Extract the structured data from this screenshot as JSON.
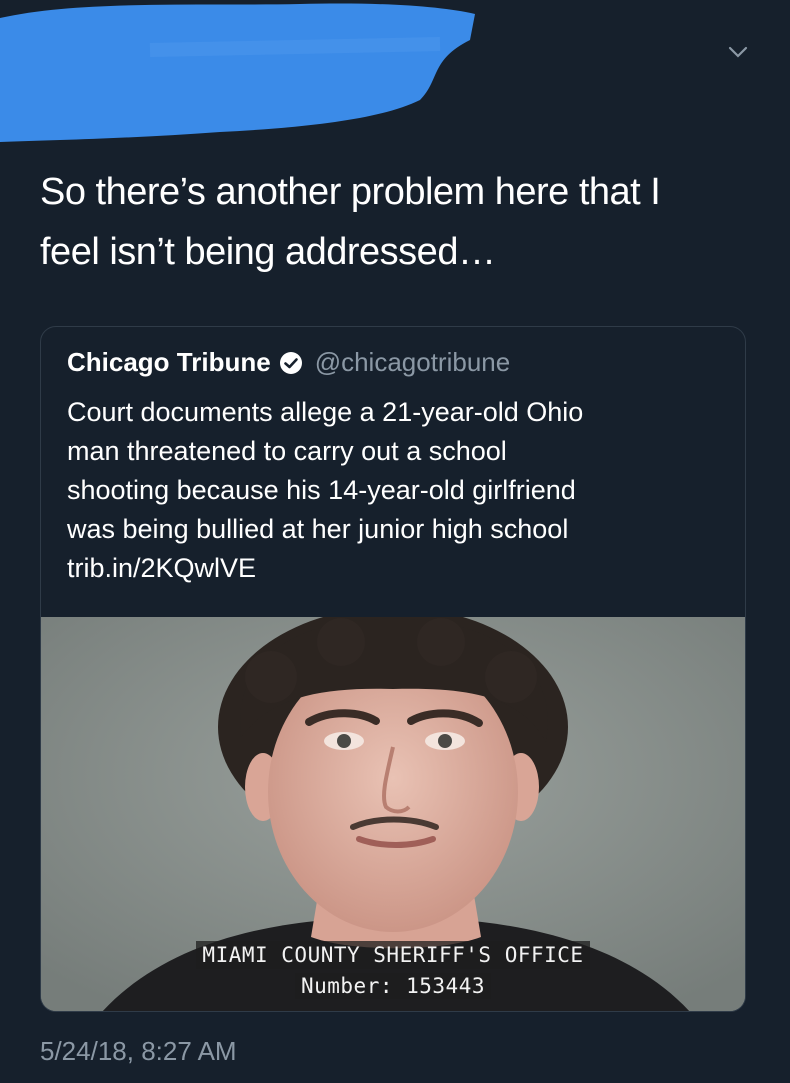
{
  "tweet": {
    "line1": "So there’s another problem here that I",
    "line2": "feel isn’t being addressed…",
    "timestamp": "5/24/18, 8:27 AM"
  },
  "quoted": {
    "name": "Chicago Tribune",
    "handle": "@chicagotribune",
    "text_lines": [
      "Court documents allege a 21-year-old Ohio",
      "man threatened to carry out a school",
      "shooting because his 14-year-old girlfriend",
      "was being bullied at her junior high school",
      "trib.in/2KQwlVE"
    ],
    "image_caption_line1": "MIAMI COUNTY SHERIFF'S OFFICE",
    "image_caption_line2": "Number: 153443"
  },
  "icons": {
    "menu": "chevron-down-icon",
    "verified": "verified-badge-icon"
  },
  "colors": {
    "background": "#16202c",
    "redaction": "#3b8be8",
    "muted": "#8b98a5"
  }
}
